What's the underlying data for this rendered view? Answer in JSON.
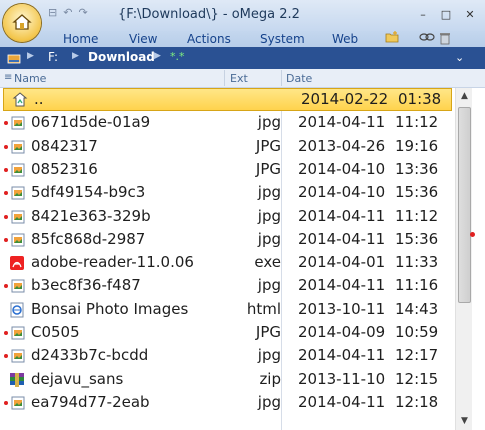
{
  "window": {
    "title": "{F:\\Download\\} - oMega 2.2",
    "minimize": "–",
    "maximize": "□",
    "close": "✕"
  },
  "qat": {
    "a": "⊟",
    "b": "↶",
    "c": "↷"
  },
  "menu": [
    "Home",
    "View",
    "Actions",
    "System",
    "Web"
  ],
  "address": {
    "drive": "F:",
    "folder": "Download",
    "filter": "*.*"
  },
  "columns": {
    "name": "Name",
    "ext": "Ext",
    "date": "Date"
  },
  "files": [
    {
      "name": "..",
      "ext": "",
      "date": "2014-02-22",
      "time": "01:38",
      "icon": "folder-up-icon",
      "selected": true
    },
    {
      "name": "0671d5de-01a9",
      "ext": "jpg",
      "date": "2014-04-11",
      "time": "11:12",
      "icon": "image-icon"
    },
    {
      "name": "0842317",
      "ext": "JPG",
      "date": "2013-04-26",
      "time": "19:16",
      "icon": "image-icon"
    },
    {
      "name": "0852316",
      "ext": "JPG",
      "date": "2014-04-10",
      "time": "13:36",
      "icon": "image-icon"
    },
    {
      "name": "5df49154-b9c3",
      "ext": "jpg",
      "date": "2014-04-10",
      "time": "15:36",
      "icon": "image-icon"
    },
    {
      "name": "8421e363-329b",
      "ext": "jpg",
      "date": "2014-04-11",
      "time": "11:12",
      "icon": "image-icon"
    },
    {
      "name": "85fc868d-2987",
      "ext": "jpg",
      "date": "2014-04-11",
      "time": "15:36",
      "icon": "image-icon"
    },
    {
      "name": "adobe-reader-11.0.06",
      "ext": "exe",
      "date": "2014-04-01",
      "time": "11:33",
      "icon": "pdf-icon"
    },
    {
      "name": "b3ec8f36-f487",
      "ext": "jpg",
      "date": "2014-04-11",
      "time": "11:16",
      "icon": "image-icon"
    },
    {
      "name": "Bonsai Photo Images",
      "ext": "html",
      "date": "2013-10-11",
      "time": "14:43",
      "icon": "html-icon"
    },
    {
      "name": "C0505",
      "ext": "JPG",
      "date": "2014-04-09",
      "time": "10:59",
      "icon": "image-icon"
    },
    {
      "name": "d2433b7c-bcdd",
      "ext": "jpg",
      "date": "2014-04-11",
      "time": "12:17",
      "icon": "image-icon"
    },
    {
      "name": "dejavu_sans",
      "ext": "zip",
      "date": "2013-11-10",
      "time": "12:15",
      "icon": "archive-icon"
    },
    {
      "name": "ea794d77-2eab",
      "ext": "jpg",
      "date": "2014-04-11",
      "time": "12:18",
      "icon": "image-icon"
    }
  ],
  "colors": {
    "accent": "#2a5193",
    "selection": "#ffd24a"
  }
}
